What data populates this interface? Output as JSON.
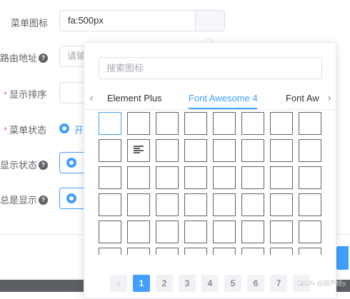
{
  "form": {
    "icon_label": "菜单图标",
    "icon_value": "fa:500px",
    "route_label": "路由地址",
    "route_placeholder": "请输",
    "sort_label": "显示排序",
    "status_label": "菜单状态",
    "status_option": "开",
    "visible_label": "显示状态",
    "always_label": "总是显示",
    "required_mark": "*",
    "help_mark": "?"
  },
  "picker": {
    "search_placeholder": "搜索图标",
    "prev_arrow": "‹",
    "next_arrow": "›",
    "tabs": [
      {
        "label": "Element Plus",
        "active": false
      },
      {
        "label": "Font Awesome 4",
        "active": true
      },
      {
        "label": "Font Aw",
        "active": false
      }
    ],
    "grid": {
      "rows": 6,
      "cols": 8,
      "selected_index": 0,
      "icons": [
        {
          "index": 9,
          "name": "align-left-icon"
        }
      ]
    },
    "pagination": {
      "prev": "‹",
      "next": "›",
      "pages": [
        "1",
        "2",
        "3",
        "4",
        "5",
        "6",
        "7"
      ],
      "current": "1"
    }
  },
  "watermark": "CSDN @葫芦娃y",
  "colors": {
    "accent": "#409eff",
    "required": "#f56c6c",
    "text": "#606266",
    "border": "#dcdfe6"
  }
}
